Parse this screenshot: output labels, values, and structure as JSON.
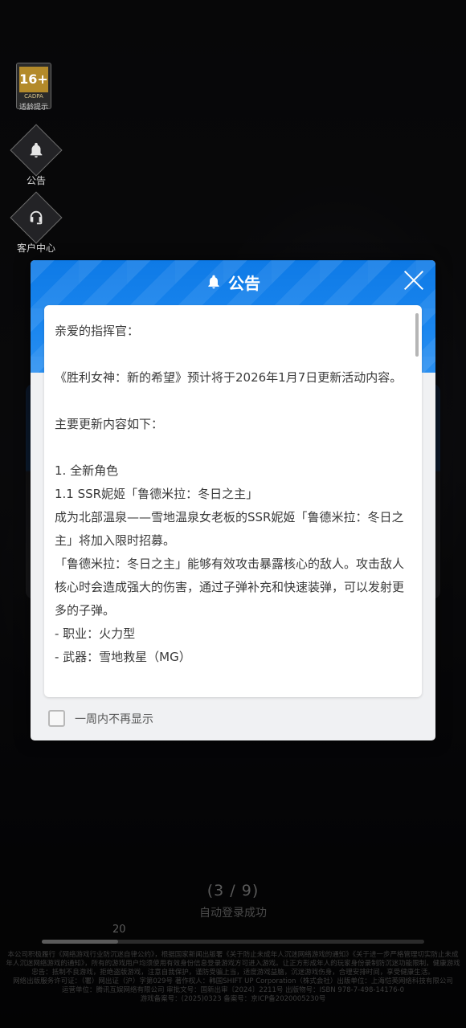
{
  "background": {
    "age_badge": {
      "rating": "16+",
      "org": "CADPA",
      "tip": "适龄提示"
    },
    "side_buttons": [
      {
        "icon": "bell-icon",
        "label": "公告"
      },
      {
        "icon": "headset-icon",
        "label": "客户中心"
      }
    ],
    "page_counter": "(3 / 9)",
    "login_status": "自动登录成功",
    "progress": {
      "label": "20",
      "fraction": 0.2
    },
    "legal_lines": [
      "本公司积极履行《网络游戏行业防沉迷自律公约》，根据国家新闻出版署《关于防止未成年人沉迷网络游戏的通知》《关于进一步严格管理切实防止未成年人沉迷网络游戏的通知》，所有的游戏用户均须使用有效身份信息登录游戏方可进入游戏。让正方形成年人的玩家身份录制防沉迷功能限制，健康游戏忠告：抵制不良游戏，拒绝盗版游戏，注意自我保护，谨防受骗上当，适度游戏益脑，沉迷游戏伤身，合理安排时间，享受健康生活。",
      "网络出版服务许可证：（署）网出证（沪）字第029号 著作权人：韩国SHIFT UP Corporation（株式会社）出版单位：上海恺英网络科技有限公司",
      "运营单位：腾讯互娱网络有限公司 审批文号：国新出审〔2024〕2211号 出版物号：ISBN 978-7-498-14176-0",
      "游戏备案号：(2025)0323 备案号：京ICP备2020005230号"
    ]
  },
  "modal": {
    "title": "公告",
    "title_icon": "bell-icon",
    "close_icon": "close-icon",
    "content": {
      "greeting": "亲爱的指挥官：",
      "intro": "《胜利女神：新的希望》预计将于2026年1月7日更新活动内容。",
      "section_heading": "主要更新内容如下：",
      "item_title": "1. 全新角色",
      "sub_title": "1.1 SSR妮姬「鲁德米拉：冬日之主」",
      "desc_1": "成为北部温泉——雪地温泉女老板的SSR妮姬「鲁德米拉：冬日之主」将加入限时招募。",
      "desc_2": "「鲁德米拉：冬日之主」能够有效攻击暴露核心的敌人。攻击敌人核心时会造成强大的伤害，通过子弹补充和快速装弹，可以发射更多的子弹。",
      "role": "- 职业：火力型",
      "weapon": "- 武器：雪地救星（MG）"
    },
    "scroll_fraction": 0.0,
    "dont_show_label": "一周内不再显示",
    "dont_show_checked": false
  }
}
